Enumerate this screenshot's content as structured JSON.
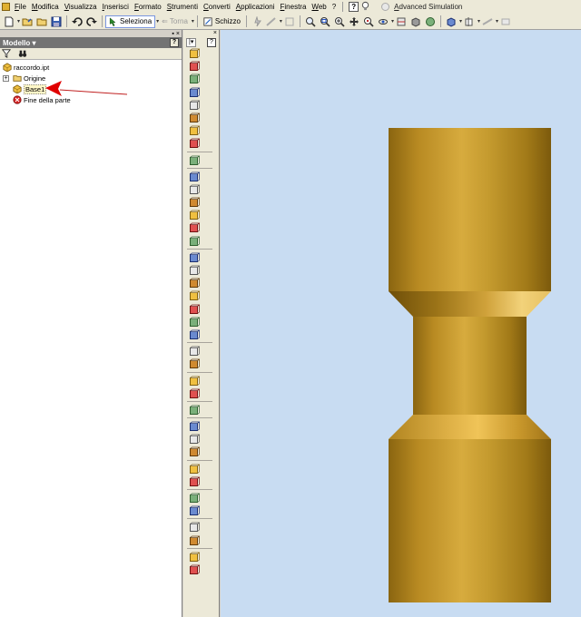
{
  "menu": {
    "items": [
      "File",
      "Modifica",
      "Visualizza",
      "Inserisci",
      "Formato",
      "Strumenti",
      "Converti",
      "Applicazioni",
      "Finestra",
      "Web"
    ],
    "help_mark": "?",
    "advanced_simulation": "Advanced Simulation"
  },
  "toolbar": {
    "select_label": "Seleziona",
    "return_label": "Torna",
    "sketch_label": "Schizzo"
  },
  "browser": {
    "title": "Modello",
    "title_dropdown": "▾",
    "help": "?",
    "tree": {
      "root": "raccordo.ipt",
      "origin": "Origine",
      "expander": "+",
      "base": "Base1",
      "end": "Fine della parte"
    }
  },
  "panel_bar": {
    "dropdown": "|▾",
    "help": "?",
    "tools": [
      "extrude-icon",
      "revolve-icon",
      "sweep-icon",
      "loft-icon",
      "coil-icon",
      "rib-icon",
      "emboss-icon",
      "decal-icon",
      "derive-icon",
      "hole-icon",
      "shell-icon",
      "fillet-icon",
      "chamfer-icon",
      "thread-icon",
      "split-icon",
      "face-draft-icon",
      "thicken-icon",
      "boundary-patch-icon",
      "stitch-icon",
      "sculpt-icon",
      "replace-face-icon",
      "delete-face-icon",
      "move-face-icon",
      "grill-icon",
      "rectangular-pattern-icon",
      "circular-pattern-icon",
      "mirror-icon",
      "work-plane-icon",
      "work-axis-icon",
      "work-point-icon",
      "promote-icon",
      "derived-component-icon",
      "parameters-icon",
      "view-face-icon",
      "ifeature-icon",
      "table-icon",
      "lip-icon",
      "rest-icon"
    ]
  },
  "viewport": {
    "background": "#c8dcf2",
    "model_color": "#c49a28"
  }
}
